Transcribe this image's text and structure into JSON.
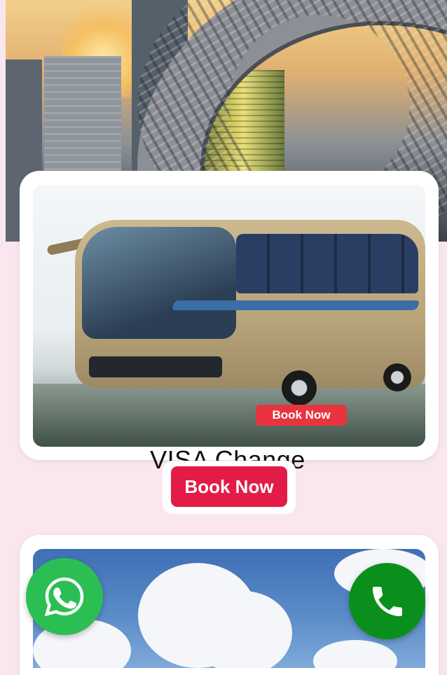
{
  "hero": {
    "image": "city-skyline-museum-of-the-future"
  },
  "cards": [
    {
      "image": "luxury-coach-bus",
      "image_badge": "Book Now",
      "title": "VISA Change",
      "button": "Book Now"
    },
    {
      "image": "sky-clouds"
    }
  ],
  "floating": {
    "whatsapp_icon": "whatsapp-icon",
    "call_icon": "phone-icon",
    "whatsapp_color": "#2bbf53",
    "call_color": "#0a8f1c"
  },
  "colors": {
    "background": "#f9e6ef",
    "accent": "#e31c47"
  }
}
